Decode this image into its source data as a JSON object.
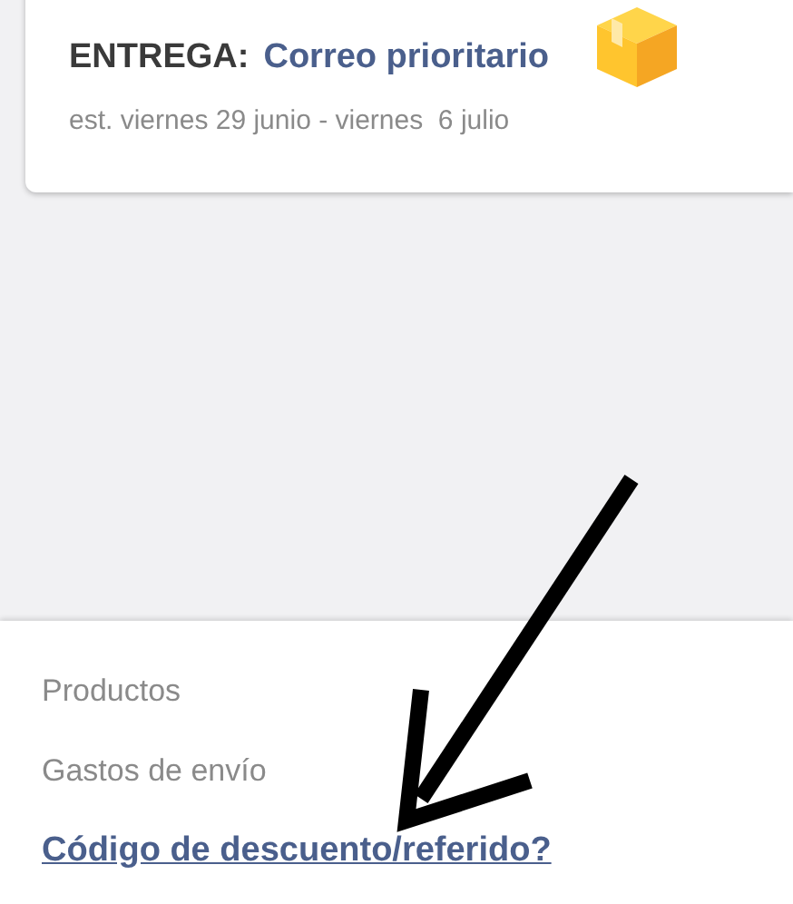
{
  "delivery": {
    "label": "ENTREGA:",
    "method": "Correo prioritario",
    "estimate": "est. viernes 29 junio - viernes  6 julio"
  },
  "summary": {
    "rows": [
      "Productos",
      "Gastos de envío"
    ],
    "discount_link": "Código de descuento/referido?"
  }
}
